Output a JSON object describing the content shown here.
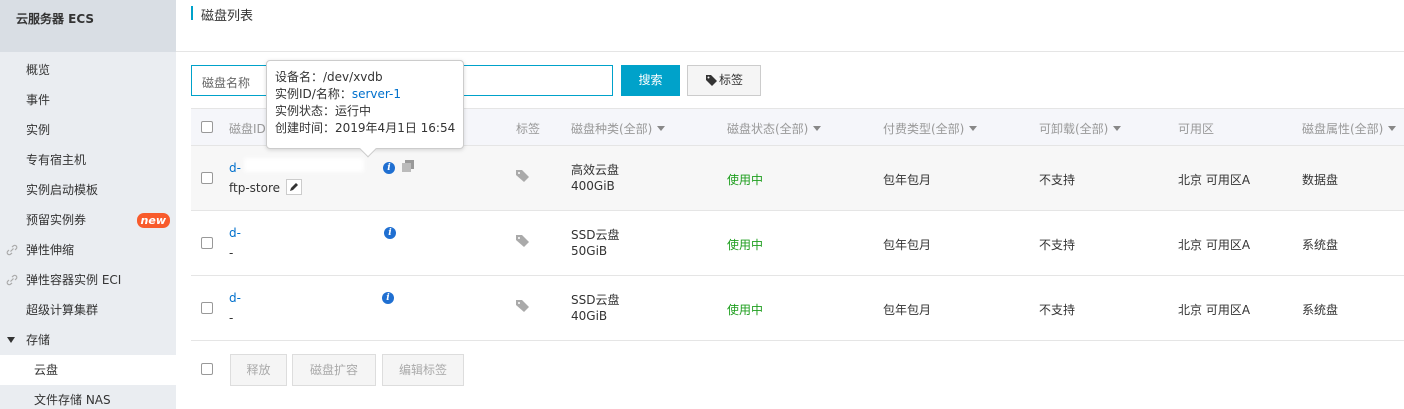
{
  "sidebar": {
    "title": "云服务器 ECS",
    "items": [
      {
        "label": "概览"
      },
      {
        "label": "事件"
      },
      {
        "label": "实例"
      },
      {
        "label": "专有宿主机"
      },
      {
        "label": "实例启动模板"
      },
      {
        "label": "预留实例券",
        "badge": "new"
      },
      {
        "label": "弹性伸缩"
      },
      {
        "label": "弹性容器实例 ECI"
      },
      {
        "label": "超级计算集群"
      },
      {
        "label": "存储"
      },
      {
        "label": "云盘"
      },
      {
        "label": "文件存储 NAS"
      }
    ]
  },
  "header": {
    "title": "磁盘列表"
  },
  "search": {
    "label": "磁盘名称",
    "value": "",
    "button": "搜索",
    "tag_button": "标签"
  },
  "table": {
    "columns": [
      "磁盘ID",
      "标签",
      "磁盘种类(全部)",
      "磁盘状态(全部)",
      "付费类型(全部)",
      "可卸载(全部)",
      "可用区",
      "磁盘属性(全部)"
    ],
    "rows": [
      {
        "id": "d-",
        "name": "ftp-store",
        "type": "高效云盘",
        "size": "400GiB",
        "status": "使用中",
        "billing": "包年包月",
        "detachable": "不支持",
        "zone": "北京 可用区A",
        "attr": "数据盘"
      },
      {
        "id": "d-",
        "name": "-",
        "type": "SSD云盘",
        "size": "50GiB",
        "status": "使用中",
        "billing": "包年包月",
        "detachable": "不支持",
        "zone": "北京 可用区A",
        "attr": "系统盘"
      },
      {
        "id": "d-",
        "name": "-",
        "type": "SSD云盘",
        "size": "40GiB",
        "status": "使用中",
        "billing": "包年包月",
        "detachable": "不支持",
        "zone": "北京 可用区A",
        "attr": "系统盘"
      }
    ],
    "footer_buttons": [
      "释放",
      "磁盘扩容",
      "编辑标签"
    ]
  },
  "tooltip": {
    "device_label": "设备名：",
    "device_value": "/dev/xvdb",
    "instance_label": "实例ID/名称：",
    "instance_value": "server-1",
    "state_label": "实例状态：",
    "state_value": "运行中",
    "created_label": "创建时间：",
    "created_value": "2019年4月1日 16:54"
  },
  "colors": {
    "accent": "#00a2ca",
    "link": "#0070cc",
    "status_ok": "#1e9e1e",
    "badge": "#f85b2c"
  }
}
